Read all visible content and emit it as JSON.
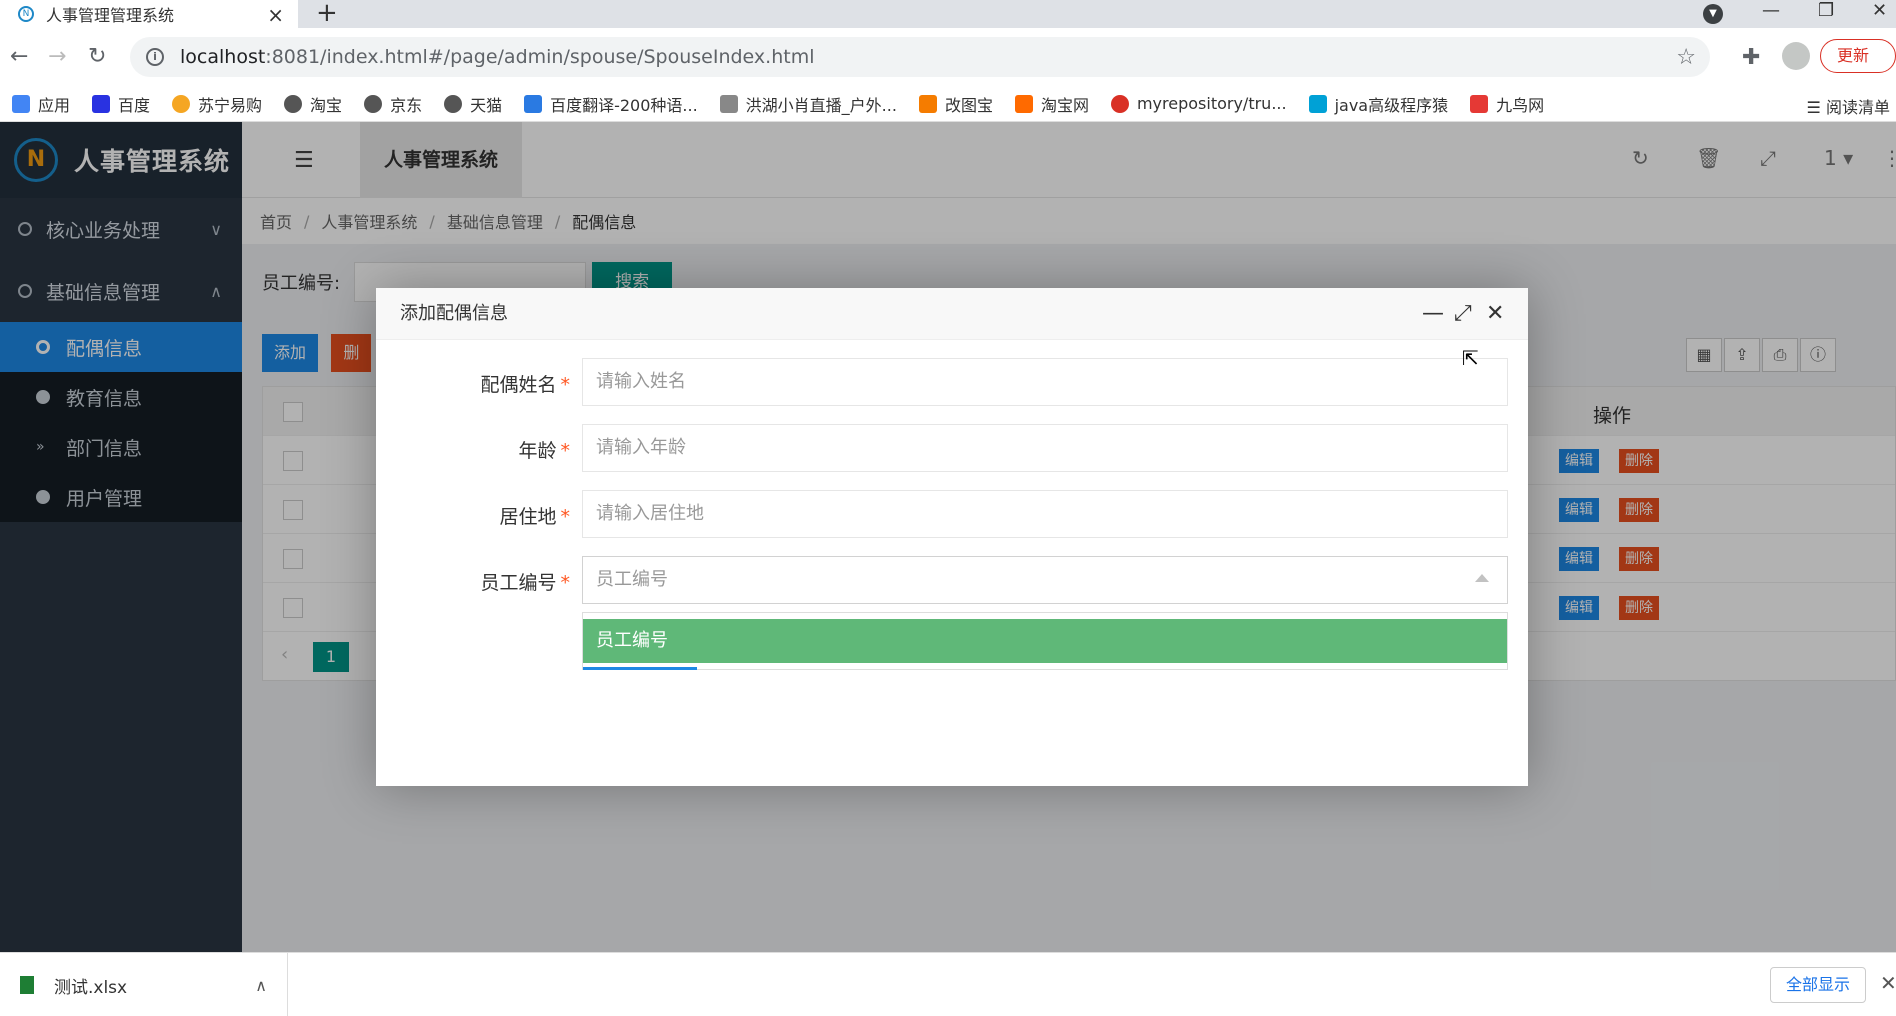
{
  "browser": {
    "tab_title": "人事管理管理系统",
    "url_host": "localhost",
    "url_path": ":8081/index.html#/page/admin/spouse/SpouseIndex.html",
    "update_label": "更新",
    "bookmarks": [
      "应用",
      "百度",
      "苏宁易购",
      "淘宝",
      "京东",
      "天猫",
      "百度翻译-200种语...",
      "洪湖小肖直播_户外...",
      "改图宝",
      "淘宝网",
      "myrepository/tru...",
      "java高级程序猿",
      "九鸟网"
    ],
    "reading_list": "阅读清单"
  },
  "app": {
    "logo_text": "人事管理系统",
    "tab_label": "人事管理系统",
    "header_page_count": "1",
    "sidebar": {
      "groups": [
        {
          "label": "核心业务处理",
          "chevron": "∨"
        },
        {
          "label": "基础信息管理",
          "chevron": "∧"
        }
      ],
      "items": [
        {
          "label": "配偶信息"
        },
        {
          "label": "教育信息"
        },
        {
          "label": "部门信息"
        },
        {
          "label": "用户管理"
        }
      ]
    },
    "breadcrumb": [
      "首页",
      "人事管理系统",
      "基础信息管理",
      "配偶信息"
    ],
    "search": {
      "label": "员工编号:",
      "button": "搜索"
    },
    "toolbar": {
      "add": "添加",
      "delete": "删"
    },
    "table": {
      "op_header": "操作",
      "edit_label": "编辑",
      "delete_label": "删除"
    },
    "pager": {
      "current": "1"
    }
  },
  "dialog": {
    "title": "添加配偶信息",
    "fields": [
      {
        "label": "配偶姓名",
        "placeholder": "请输入姓名"
      },
      {
        "label": "年龄",
        "placeholder": "请输入年龄"
      },
      {
        "label": "居住地",
        "placeholder": "请输入居住地"
      },
      {
        "label": "员工编号",
        "placeholder": "员工编号"
      }
    ],
    "dropdown_option": "员工编号"
  },
  "downloads": {
    "file_name": "测试.xlsx",
    "show_all": "全部显示"
  },
  "colors": {
    "primary": "#1e88e5",
    "teal": "#009688",
    "danger": "#e8501f",
    "option_green": "#5fb878",
    "sidebar_bg": "#2a3542"
  }
}
